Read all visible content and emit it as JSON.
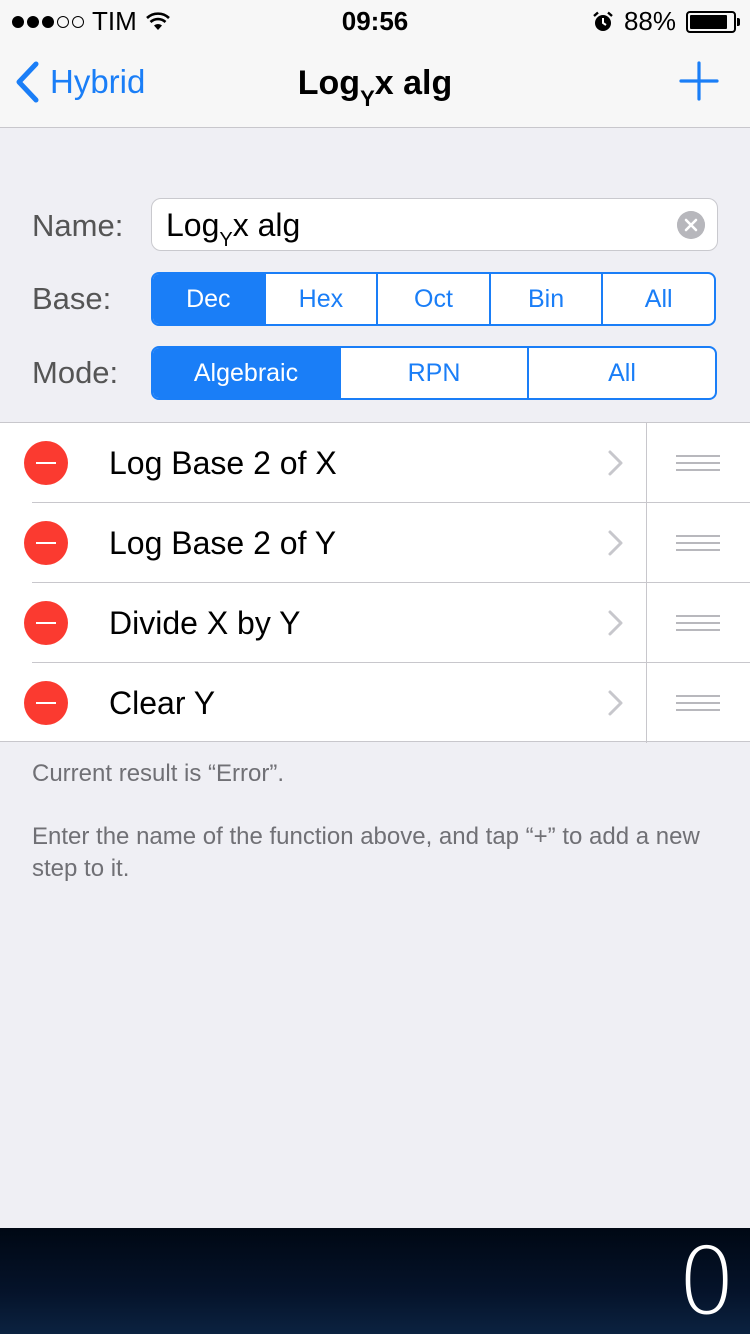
{
  "status_bar": {
    "carrier": "TIM",
    "time": "09:56",
    "battery_percent": "88%",
    "battery_level": 0.88,
    "signal_bars_filled": 3,
    "signal_bars_total": 5
  },
  "nav": {
    "back_label": "Hybrid",
    "title_prefix": "Log",
    "title_subscript": "Y",
    "title_suffix": "x alg"
  },
  "form": {
    "name_label": "Name:",
    "name_value_prefix": "Log",
    "name_value_subscript": "Y",
    "name_value_suffix": "x alg",
    "base_label": "Base:",
    "base_options": [
      "Dec",
      "Hex",
      "Oct",
      "Bin",
      "All"
    ],
    "base_selected": "Dec",
    "mode_label": "Mode:",
    "mode_options": [
      "Algebraic",
      "RPN",
      "All"
    ],
    "mode_selected": "Algebraic"
  },
  "steps": [
    {
      "label": "Log Base 2 of X"
    },
    {
      "label": "Log Base 2 of Y"
    },
    {
      "label": "Divide X by Y"
    },
    {
      "label": "Clear Y"
    }
  ],
  "notes": {
    "result": "Current result is “Error”.",
    "help": "Enter the name of the function above, and tap “+” to add a new step to it."
  },
  "display": {
    "value": "0"
  },
  "colors": {
    "accent": "#1a7ef7",
    "delete": "#fb3a30",
    "background": "#efeff4"
  }
}
